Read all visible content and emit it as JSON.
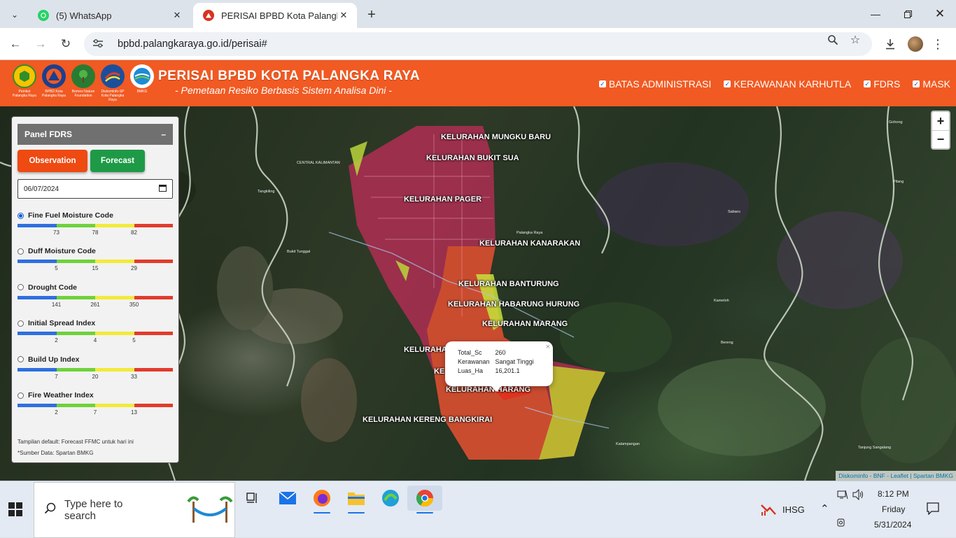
{
  "browser": {
    "tabs": [
      {
        "title": "(5) WhatsApp",
        "active": false
      },
      {
        "title": "PERISAI BPBD Kota Palangka Ra",
        "active": true
      }
    ],
    "url": "bpbd.palangkaraya.go.id/perisai#"
  },
  "header": {
    "logos": [
      {
        "caption": "Pemkot Palangka Raya"
      },
      {
        "caption": "BPBD Kota Palangka Raya"
      },
      {
        "caption": "Borneo Nature Foundation"
      },
      {
        "caption": "Diskominfo-SP Kota Palangka Raya"
      },
      {
        "caption": "BMKG"
      }
    ],
    "title": "PERISAI BPBD KOTA PALANGKA RAYA",
    "subtitle": "- Pemetaan Resiko Berbasis Sistem Analisa Dini -",
    "layers": [
      {
        "label": "BATAS ADMINISTRASI",
        "checked": true
      },
      {
        "label": "KERAWANAN KARHUTLA",
        "checked": true
      },
      {
        "label": "FDRS",
        "checked": true
      },
      {
        "label": "MASK",
        "checked": true
      }
    ]
  },
  "panel": {
    "title": "Panel FDRS",
    "collapse": "–",
    "observation": "Observation",
    "forecast": "Forecast",
    "date": "06/07/2024",
    "indices": [
      {
        "name": "Fine Fuel Moisture Code",
        "selected": true,
        "ticks": [
          "73",
          "78",
          "82"
        ]
      },
      {
        "name": "Duff Moisture Code",
        "selected": false,
        "ticks": [
          "5",
          "15",
          "29"
        ]
      },
      {
        "name": "Drought Code",
        "selected": false,
        "ticks": [
          "141",
          "261",
          "350"
        ]
      },
      {
        "name": "Initial Spread Index",
        "selected": false,
        "ticks": [
          "2",
          "4",
          "5"
        ]
      },
      {
        "name": "Build Up Index",
        "selected": false,
        "ticks": [
          "7",
          "20",
          "33"
        ]
      },
      {
        "name": "Fire Weather Index",
        "selected": false,
        "ticks": [
          "2",
          "7",
          "13"
        ]
      }
    ],
    "scale_colors": [
      "#2f6fe0",
      "#6fd23a",
      "#f3ea3a",
      "#e23b2c"
    ],
    "note1": "Tampilan default: Forecast FFMC untuk hari ini",
    "note2": "*Sumber Data: Spartan BMKG"
  },
  "map": {
    "labels": {
      "mungku_baru": "KELURAHAN MUNGKU BARU",
      "bukit_sua": "KELURAHAN BUKIT SUA",
      "pager": "KELURAHAN PAGER",
      "kanarakan": "KELURAHAN KANARAKAN",
      "banturung": "KELURAHAN BANTURUNG",
      "habarung_hurung": "KELURAHAN HABARUNG HURUNG",
      "marang": "KELURAHAN MARANG",
      "kelurahan_partial": "KELURAHAN",
      "ke_partial": "KE",
      "tumbang_tahai": "KELURAHAN HARANG",
      "kereng_bangkirai": "KELURAHAN KERENG BANGKIRAI"
    },
    "places": {
      "central_kalimantan": "CENTRAL KALIMANTAN",
      "tangkiling": "Tangkiling",
      "bukit_tunggal": "Bukit Tunggal",
      "palangka_raya": "Palangka Raya",
      "sabaru": "Sabaru",
      "kameloh": "Kameloh",
      "bereng": "Bereng",
      "kalampangan": "Kalampangan",
      "tanjung_sangalang": "Tanjung Sangalang",
      "gohong": "Gohong",
      "pilang": "Pilang"
    },
    "zoom_in": "+",
    "zoom_out": "−",
    "popup": {
      "rows": [
        {
          "key": "Total_Sc",
          "value": "260"
        },
        {
          "key": "Kerawanan",
          "value": "Sangat Tinggi"
        },
        {
          "key": "Luas_Ha",
          "value": "16,201.1"
        }
      ],
      "close": "×"
    },
    "attribution": "Diskominfo - BNF - Leaflet | Spartan BMKG"
  },
  "taskbar": {
    "search_placeholder": "Type here to search",
    "ihsg": "IHSG",
    "time": "8:12 PM",
    "day": "Friday",
    "date": "5/31/2024"
  }
}
